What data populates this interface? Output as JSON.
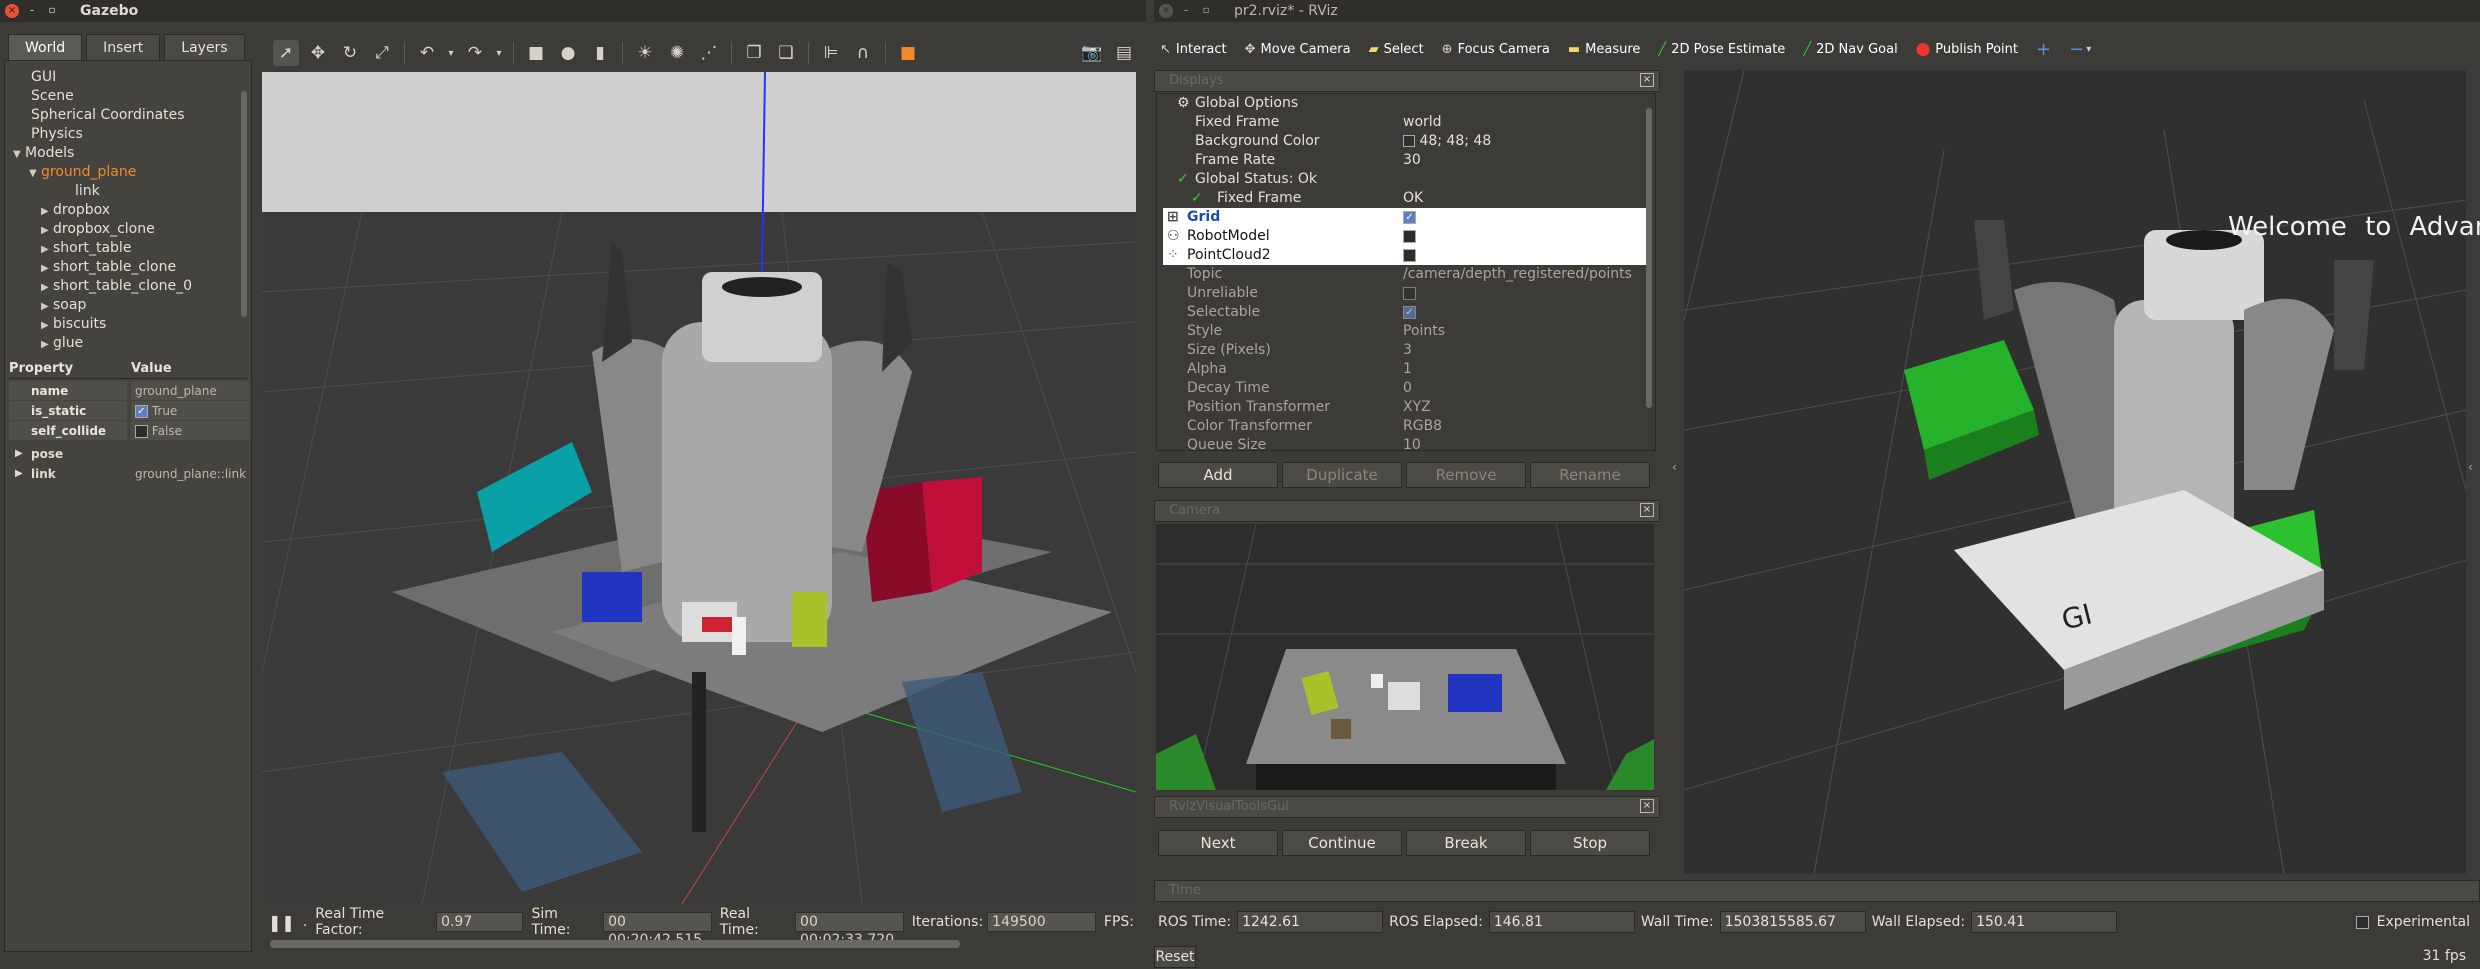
{
  "gazebo": {
    "title": "Gazebo",
    "tabs": [
      "World",
      "Insert",
      "Layers"
    ],
    "tree": {
      "gui": "GUI",
      "scene": "Scene",
      "spherical": "Spherical Coordinates",
      "physics": "Physics",
      "models": "Models",
      "ground_plane": "ground_plane",
      "link": "link",
      "items": [
        "dropbox",
        "dropbox_clone",
        "short_table",
        "short_table_clone",
        "short_table_clone_0",
        "soap",
        "biscuits",
        "glue"
      ]
    },
    "props": {
      "h_property": "Property",
      "h_value": "Value",
      "name_k": "name",
      "name_v": "ground_plane",
      "static_k": "is_static",
      "static_v": "True",
      "collide_k": "self_collide",
      "collide_v": "False",
      "pose_k": "pose",
      "link_k": "link",
      "link_v": "ground_plane::link"
    },
    "status": {
      "rtf_label": "Real Time Factor:",
      "rtf_value": "0.97",
      "sim_label": "Sim Time:",
      "sim_value": "00 00:20:42.515",
      "real_label": "Real Time:",
      "real_value": "00 00:02:33.720",
      "iter_label": "Iterations:",
      "iter_value": "149500",
      "fps_label": "FPS:"
    }
  },
  "rviz": {
    "title": "pr2.rviz* - RViz",
    "tools": [
      "Interact",
      "Move Camera",
      "Select",
      "Focus Camera",
      "Measure",
      "2D Pose Estimate",
      "2D Nav Goal",
      "Publish Point"
    ],
    "displays_title": "Displays",
    "displays": {
      "global_options": "Global Options",
      "fixed_frame_k": "Fixed Frame",
      "fixed_frame_v": "world",
      "bg_k": "Background Color",
      "bg_v": "48; 48; 48",
      "rate_k": "Frame Rate",
      "rate_v": "30",
      "status_k": "Global Status: Ok",
      "ff2_k": "Fixed Frame",
      "ff2_v": "OK",
      "grid": "Grid",
      "robot": "RobotModel",
      "pc": "PointCloud2",
      "topic_k": "Topic",
      "topic_v": "/camera/depth_registered/points",
      "unrel_k": "Unreliable",
      "selectable_k": "Selectable",
      "style_k": "Style",
      "style_v": "Points",
      "size_k": "Size (Pixels)",
      "size_v": "3",
      "alpha_k": "Alpha",
      "alpha_v": "1",
      "decay_k": "Decay Time",
      "decay_v": "0",
      "pos_k": "Position Transformer",
      "pos_v": "XYZ",
      "color_k": "Color Transformer",
      "color_v": "RGB8",
      "queue_k": "Queue Size",
      "queue_v": "10"
    },
    "disp_buttons": [
      "Add",
      "Duplicate",
      "Remove",
      "Rename"
    ],
    "camera_title": "Camera",
    "motion_title": "RvizVisualToolsGui",
    "motion_buttons": [
      "Next",
      "Continue",
      "Break",
      "Stop"
    ],
    "welcome": "Welcome to Advance Pick and Place project",
    "time": {
      "title": "Time",
      "ros_time_label": "ROS Time:",
      "ros_time": "1242.61",
      "ros_elapsed_label": "ROS Elapsed:",
      "ros_elapsed": "146.81",
      "wall_time_label": "Wall Time:",
      "wall_time": "1503815585.67",
      "wall_elapsed_label": "Wall Elapsed:",
      "wall_elapsed": "150.41",
      "experimental": "Experimental",
      "reset": "Reset",
      "fps": "31 fps"
    }
  }
}
